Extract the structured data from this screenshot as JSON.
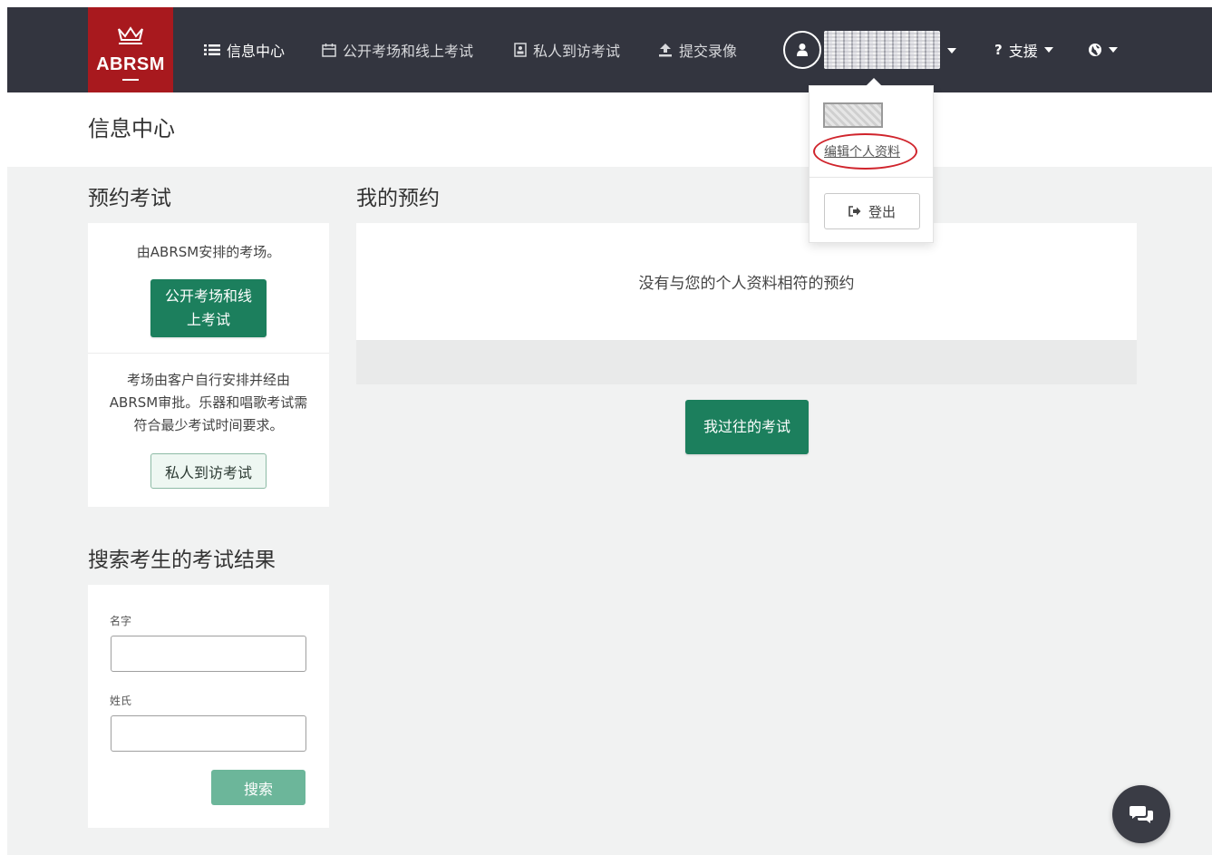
{
  "brand": {
    "logo_text": "ABRSM"
  },
  "nav": {
    "items": [
      {
        "label": "信息中心",
        "icon": "list-icon"
      },
      {
        "label": "公开考场和线上考试",
        "icon": "calendar-icon"
      },
      {
        "label": "私人到访考试",
        "icon": "id-card-icon"
      },
      {
        "label": "提交录像",
        "icon": "upload-icon"
      }
    ],
    "support_label": "支援",
    "support_icon": "question-mark-icon",
    "language_icon": "globe-icon"
  },
  "user_menu": {
    "edit_profile_label": "编辑个人资料",
    "logout_label": "登出"
  },
  "page": {
    "title": "信息中心"
  },
  "book_exam": {
    "title": "预约考试",
    "public_desc": "由ABRSM安排的考场。",
    "public_button": "公开考场和线上考试",
    "private_desc": "考场由客户自行安排并经由ABRSM审批。乐器和唱歌考试需符合最少考试时间要求。",
    "private_button": "私人到访考试"
  },
  "search_results": {
    "title": "搜索考生的考试结果",
    "first_name_label": "名字",
    "first_name_value": "",
    "last_name_label": "姓氏",
    "last_name_value": "",
    "search_button": "搜索"
  },
  "my_bookings": {
    "title": "我的预约",
    "empty_message": "没有与您的个人资料相符的预约",
    "past_exams_button": "我过往的考试"
  },
  "colors": {
    "navbar": "#33353f",
    "brand_red": "#a8191e",
    "primary_green": "#1c7f5d",
    "search_green": "#6cb69a",
    "highlight_red": "#d0242c"
  }
}
